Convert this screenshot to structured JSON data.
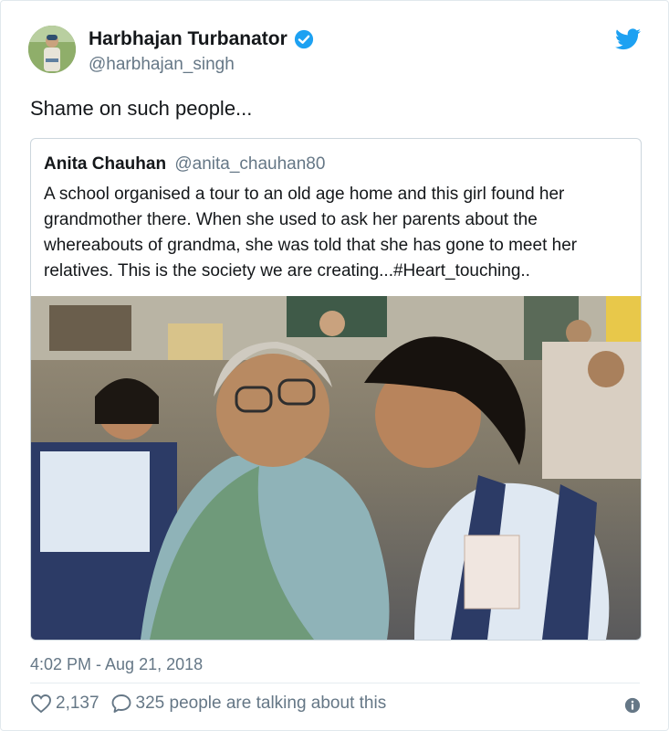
{
  "tweet": {
    "author_name": "Harbhajan Turbanator",
    "author_handle": "@harbhajan_singh",
    "text": "Shame on such people...",
    "timestamp": "4:02 PM - Aug 21, 2018",
    "likes": "2,137",
    "talking": "325 people are talking about this"
  },
  "quoted": {
    "author_name": "Anita Chauhan",
    "author_handle": "@anita_chauhan80",
    "text": "A school organised a tour to an old age home and this girl found her grandmother there. When she used to ask her parents about the whereabouts of grandma, she was told that she has gone to meet her relatives. This is the society we are creating...#Heart_touching.."
  },
  "icons": {
    "verified": "verified-badge-icon",
    "brand": "twitter-bird-icon",
    "like": "heart-icon",
    "reply": "speech-bubble-icon",
    "info": "info-icon"
  },
  "colors": {
    "brand": "#1da1f2",
    "text": "#14171a",
    "muted": "#657786"
  }
}
